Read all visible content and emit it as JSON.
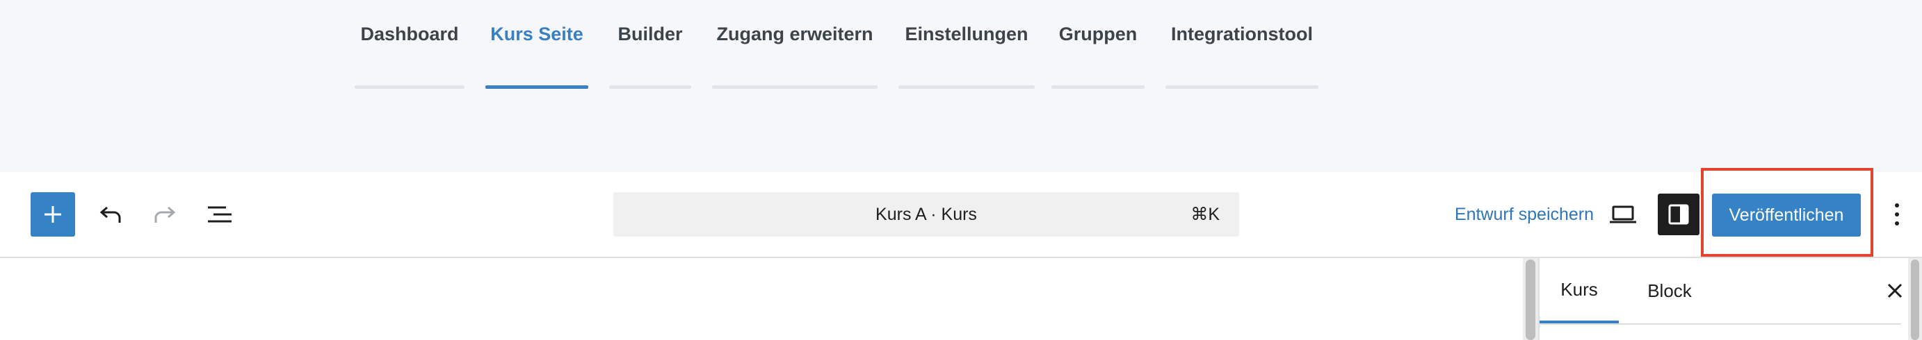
{
  "course_tabs": [
    {
      "label": "Dashboard",
      "active": false
    },
    {
      "label": "Kurs Seite",
      "active": true
    },
    {
      "label": "Builder",
      "active": false
    },
    {
      "label": "Zugang erweitern",
      "active": false
    },
    {
      "label": "Einstellungen",
      "active": false
    },
    {
      "label": "Gruppen",
      "active": false
    },
    {
      "label": "Integrationstool",
      "active": false
    }
  ],
  "toolbar": {
    "add_icon": "plus-icon",
    "undo_icon": "undo-icon",
    "redo_icon": "redo-icon",
    "list_view_icon": "list-view-icon",
    "command_bar": {
      "title": "Kurs A · Kurs",
      "shortcut": "⌘K"
    },
    "save_draft_label": "Entwurf speichern",
    "view_icon": "laptop-icon",
    "settings_icon": "sidebar-panel-icon",
    "publish_label": "Veröffentlichen",
    "more_icon": "more-vertical-icon"
  },
  "sidebar": {
    "tabs": [
      {
        "label": "Kurs",
        "active": true
      },
      {
        "label": "Block",
        "active": false
      }
    ],
    "close_icon": "close-icon"
  },
  "colors": {
    "accent": "#3582c4",
    "active_tab": "#3a7fc1",
    "highlight": "#e0452d",
    "nav_background": "#f6f7fb"
  }
}
